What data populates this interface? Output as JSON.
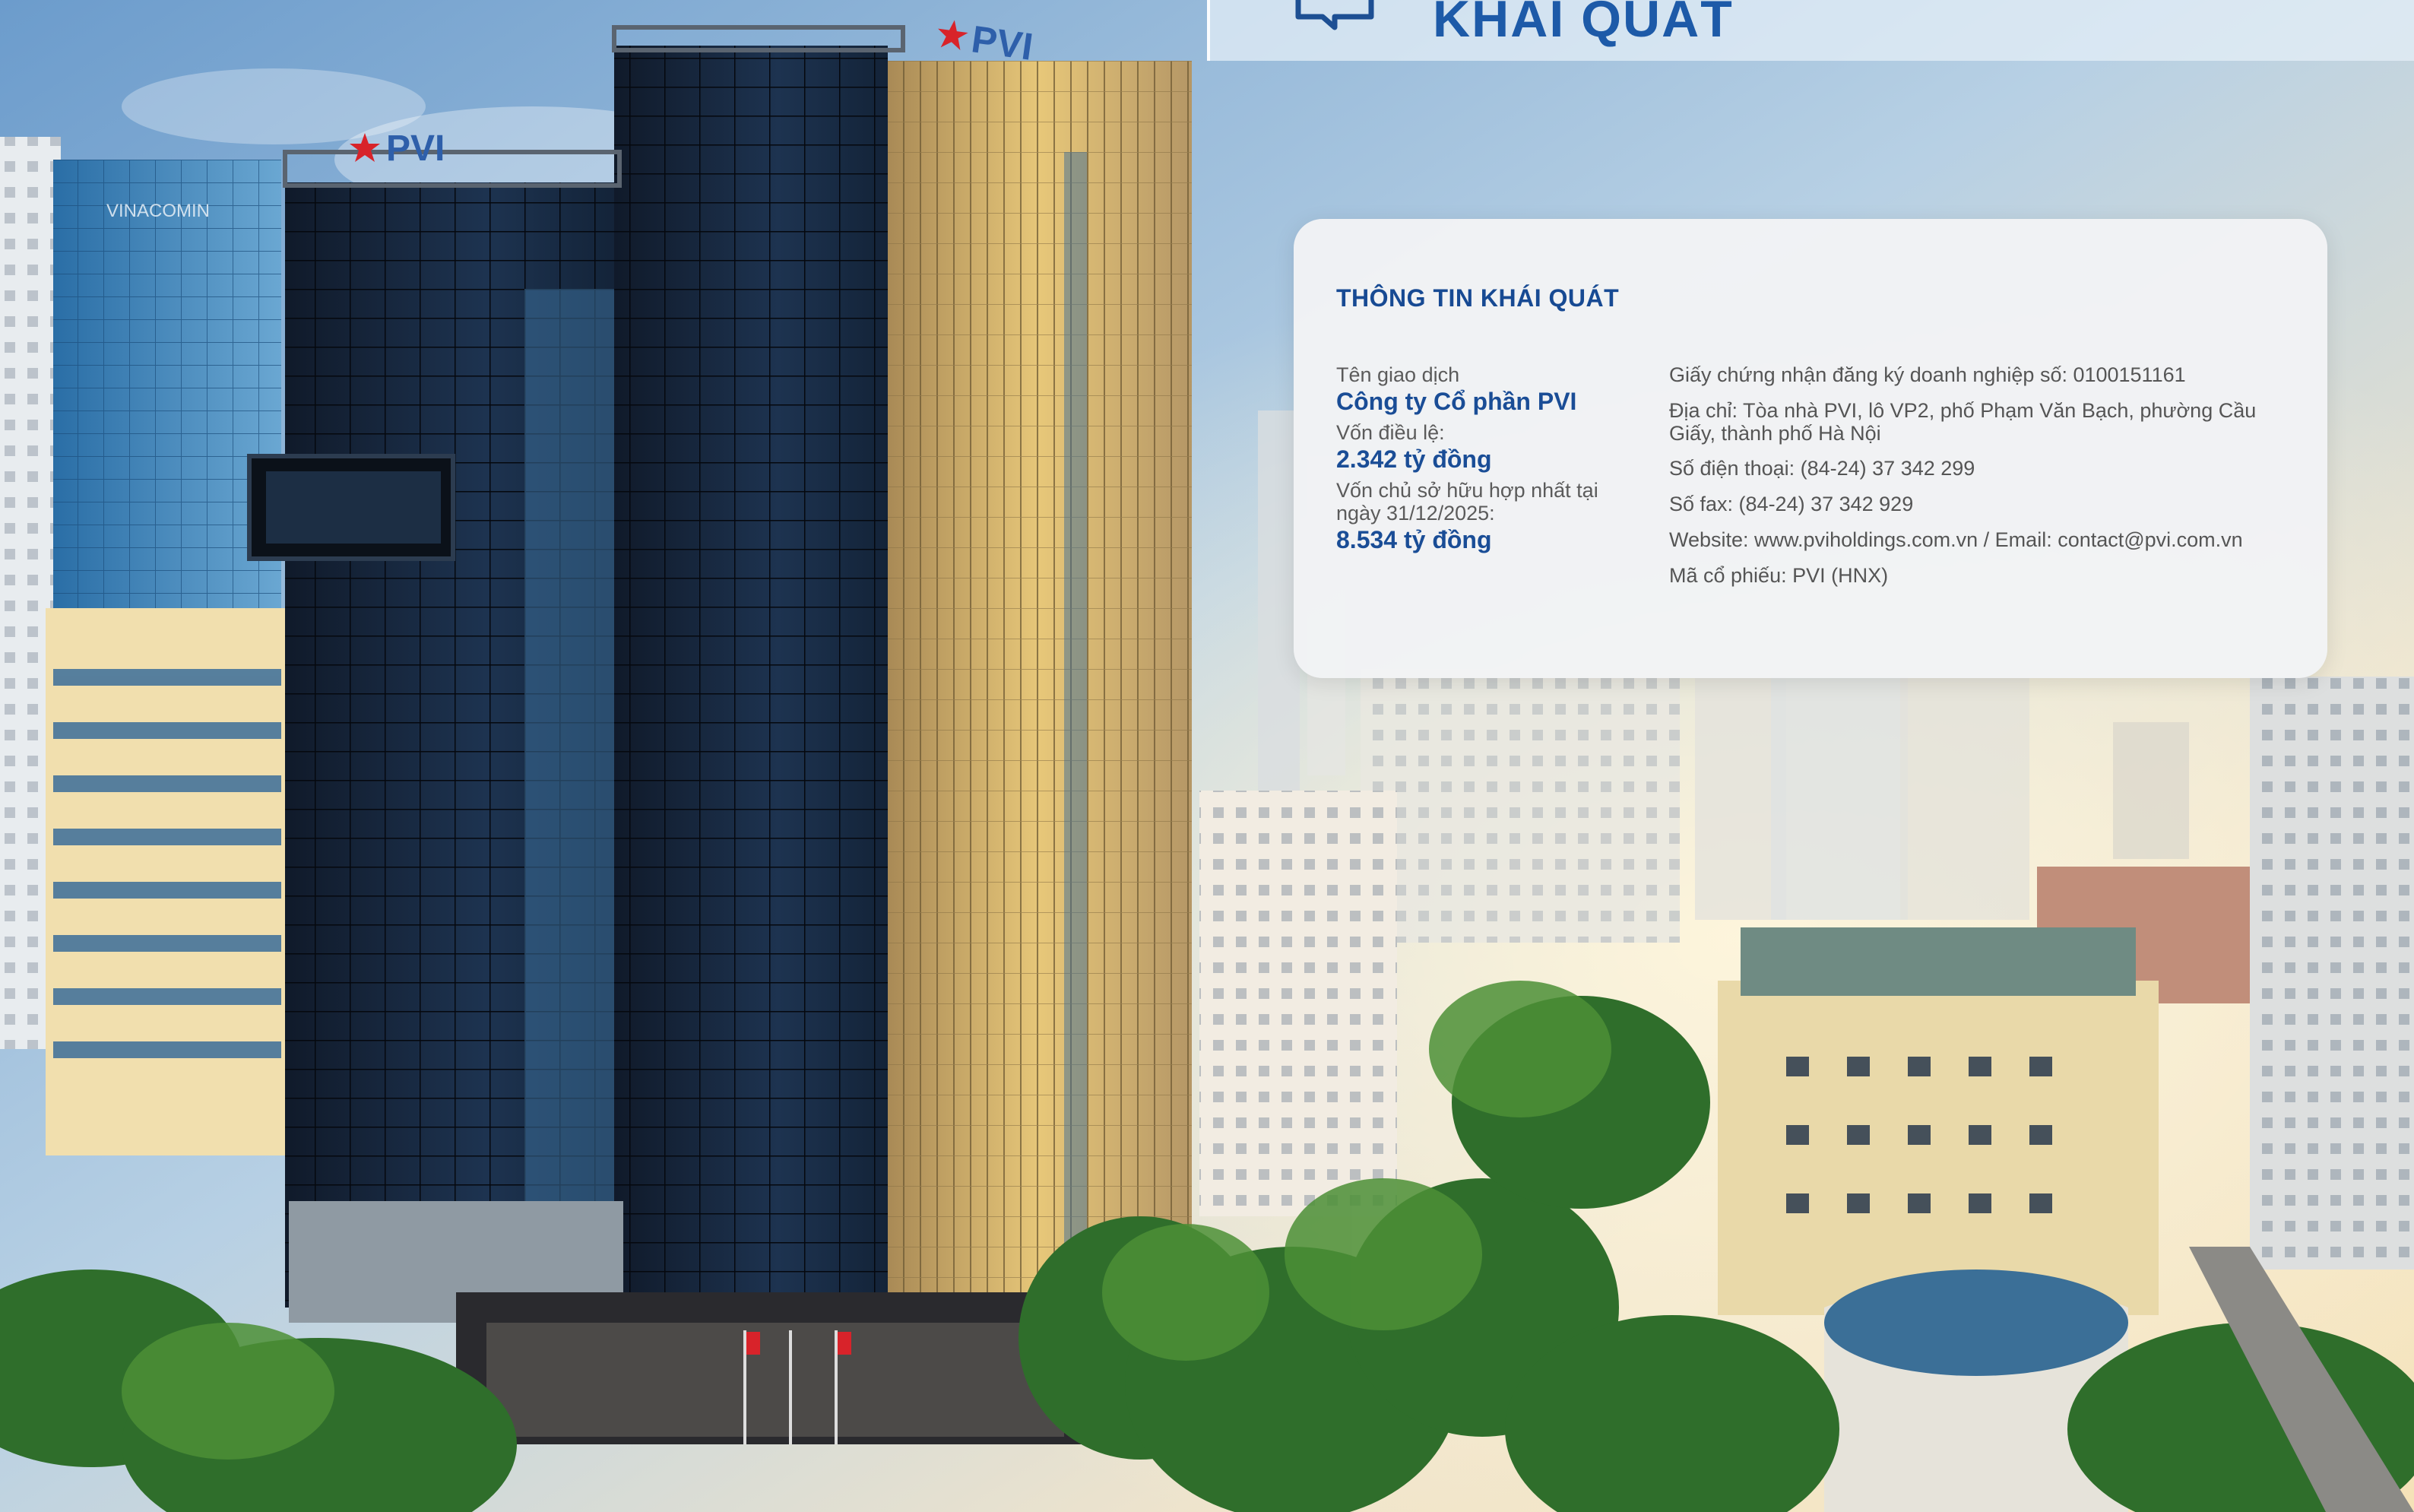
{
  "header": {
    "title": "KHÁI QUÁT"
  },
  "building_signs": {
    "left_logo": "PVI",
    "right_logo": "PVI",
    "neighbor_sign": "VINACOMIN"
  },
  "card": {
    "heading": "THÔNG TIN KHÁI QUÁT",
    "trading_name_label": "Tên giao dịch",
    "trading_name_value": "Công ty Cổ phần PVI",
    "charter_capital_label": "Vốn điều lệ:",
    "charter_capital_value": "2.342 tỷ đồng",
    "equity_label": "Vốn chủ sở hữu hợp nhất tại ngày 31/12/2025:",
    "equity_value": "8.534 tỷ đồng",
    "registration": "Giấy chứng nhận đăng ký doanh nghiệp số: 0100151161",
    "address": "Địa chỉ: Tòa nhà PVI, lô VP2, phố Phạm Văn Bạch, phường Cầu Giấy, thành phố Hà Nội",
    "phone": "Số điện thoại: (84-24) 37 342 299",
    "fax": "Số fax: (84-24) 37 342 929",
    "web_email": "Website: www.pviholdings.com.vn / Email: contact@pvi.com.vn",
    "stock_code": "Mã cổ phiếu: PVI (HNX)"
  },
  "icons": {
    "header_icon": "chat-bubble-icon"
  },
  "colors": {
    "brand_blue": "#1a4d96",
    "card_bg": "#f2f3f5",
    "logo_red": "#d8232a"
  }
}
